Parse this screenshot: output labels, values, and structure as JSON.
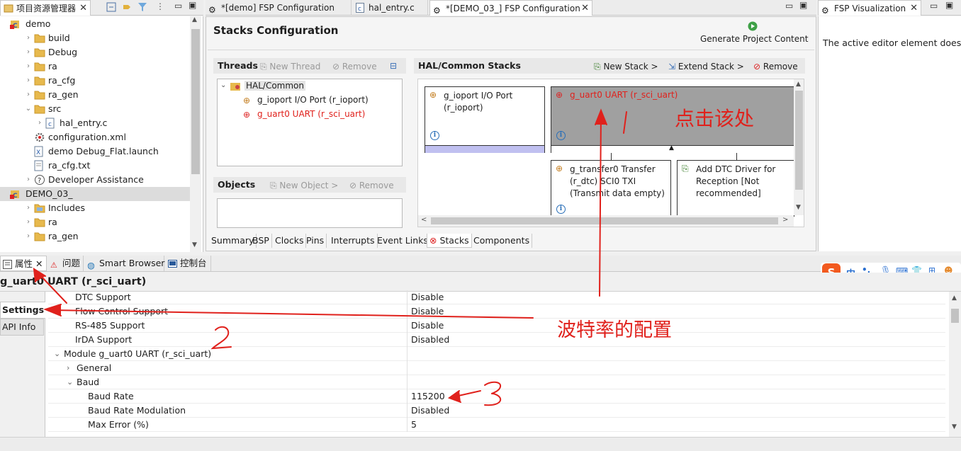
{
  "explorer": {
    "tab_label": "项目资源管理器",
    "items": [
      {
        "label": "demo"
      },
      {
        "label": "build"
      },
      {
        "label": "Debug"
      },
      {
        "label": "ra"
      },
      {
        "label": "ra_cfg"
      },
      {
        "label": "ra_gen"
      },
      {
        "label": "src"
      },
      {
        "label": "hal_entry.c"
      },
      {
        "label": "configuration.xml"
      },
      {
        "label": "demo Debug_Flat.launch"
      },
      {
        "label": "ra_cfg.txt"
      },
      {
        "label": "Developer Assistance"
      },
      {
        "label": "DEMO_03_"
      },
      {
        "label": "Includes"
      },
      {
        "label": "ra"
      },
      {
        "label": "ra_gen"
      }
    ]
  },
  "editor_tabs": [
    {
      "label": "*[demo] FSP Configuration"
    },
    {
      "label": "hal_entry.c"
    },
    {
      "label": "*[DEMO_03_] FSP Configuration"
    }
  ],
  "stacks": {
    "title": "Stacks Configuration",
    "generate_label": "Generate Project Content",
    "threads": {
      "header": "Threads",
      "new_thread": "New Thread",
      "remove": "Remove",
      "root": "HAL/Common",
      "items": [
        "g_ioport I/O Port (r_ioport)",
        "g_uart0 UART (r_sci_uart)"
      ]
    },
    "objects": {
      "header": "Objects",
      "new_object": "New Object >",
      "remove": "Remove"
    },
    "hal": {
      "header": "HAL/Common Stacks",
      "new_stack": "New Stack >",
      "extend_stack": "Extend Stack >",
      "remove": "Remove",
      "block_ioport": "g_ioport I/O Port (r_ioport)",
      "block_uart": "g_uart0 UART (r_sci_uart)",
      "block_transfer": "g_transfer0 Transfer (r_dtc) SCI0 TXI (Transmit data empty)",
      "block_dtc": "Add DTC Driver for Reception [Not recommended]"
    },
    "tabs": [
      "Summary",
      "BSP",
      "Clocks",
      "Pins",
      "Interrupts",
      "Event Links",
      "Stacks",
      "Components"
    ]
  },
  "fsp_vis": {
    "tab_label": "FSP Visualization",
    "message": "The active editor element does no"
  },
  "bottom_tabs": [
    "属性",
    "问题",
    "Smart Browser",
    "控制台"
  ],
  "ime": {
    "lang": "中",
    "punct": "•,"
  },
  "properties": {
    "title": "g_uart0 UART (r_sci_uart)",
    "side_tabs": [
      "Settings",
      "API Info"
    ],
    "rows": [
      {
        "name": "DTC Support",
        "value": "Disable"
      },
      {
        "name": "Flow Control Support",
        "value": "Disable"
      },
      {
        "name": "RS-485 Support",
        "value": "Disable"
      },
      {
        "name": "IrDA Support",
        "value": "Disabled"
      },
      {
        "name": "Module g_uart0 UART (r_sci_uart)",
        "value": ""
      },
      {
        "name": "General",
        "value": ""
      },
      {
        "name": "Baud",
        "value": ""
      },
      {
        "name": "Baud Rate",
        "value": "115200"
      },
      {
        "name": "Baud Rate Modulation",
        "value": "Disabled"
      },
      {
        "name": "Max Error (%)",
        "value": "5"
      }
    ]
  },
  "annotations": {
    "click_here": "点击该处",
    "one": "1",
    "two": "2",
    "three": "3",
    "baud_config": "波特率的配置"
  },
  "colors": {
    "accent_red": "#e0211c",
    "selected_block": "#a0a0a0",
    "active_tab_red": "#d22"
  }
}
